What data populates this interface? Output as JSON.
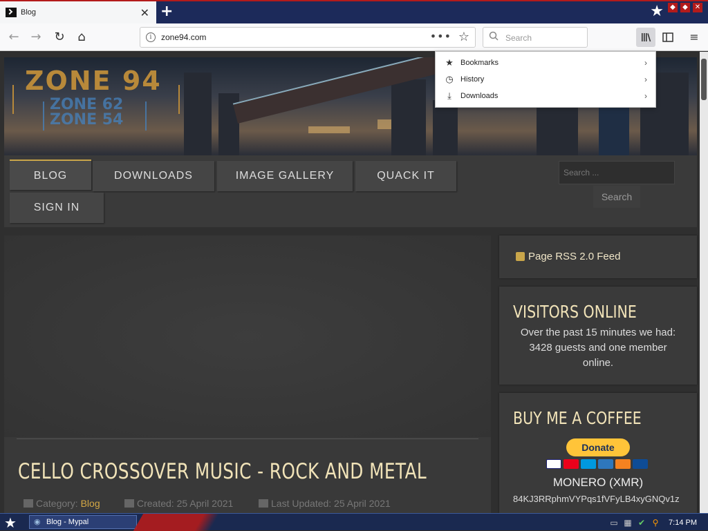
{
  "browser": {
    "tab": {
      "title": "Blog",
      "close": "✕"
    },
    "new_tab": "+",
    "url": "zone94.com",
    "search_placeholder": "Search",
    "page_actions": "•••"
  },
  "library_menu": {
    "items": [
      {
        "label": "Bookmarks",
        "icon": "star-icon"
      },
      {
        "label": "History",
        "icon": "clock-icon"
      },
      {
        "label": "Downloads",
        "icon": "download-icon"
      }
    ]
  },
  "site": {
    "logo": {
      "main": "ZONE 94",
      "sub1": "ZONE 62",
      "sub2": "ZONE 54"
    },
    "nav": {
      "items": [
        "BLOG",
        "DOWNLOADS",
        "IMAGE GALLERY",
        "QUACK IT",
        "SIGN IN"
      ],
      "active": "BLOG"
    },
    "search": {
      "placeholder": "Search ...",
      "button": "Search"
    }
  },
  "article": {
    "title": "CELLO CROSSOVER MUSIC - ROCK AND METAL",
    "category_label": "Category:",
    "category": "Blog",
    "created": "Created: 25 April 2021",
    "updated": "Last Updated: 25 April 2021"
  },
  "sidebar": {
    "rss": "Page RSS 2.0 Feed",
    "visitors": {
      "title": "VISITORS ONLINE",
      "text": "Over the past 15 minutes we had: 3428 guests and one member online."
    },
    "coffee": {
      "title": "BUY ME A COFFEE",
      "donate": "Donate",
      "monero_label": "MONERO (XMR)",
      "monero_address": "84KJ3RRphmVYPqs1fVFyLB4xyGNQv1z"
    }
  },
  "taskbar": {
    "task": "Blog - Mypal",
    "clock": "7:14 PM"
  },
  "colors": {
    "accent_gold": "#c9a64a",
    "heading": "#f1e3b8",
    "tab_strip": "#1c2a5a",
    "taskbar": "#1a2950"
  }
}
